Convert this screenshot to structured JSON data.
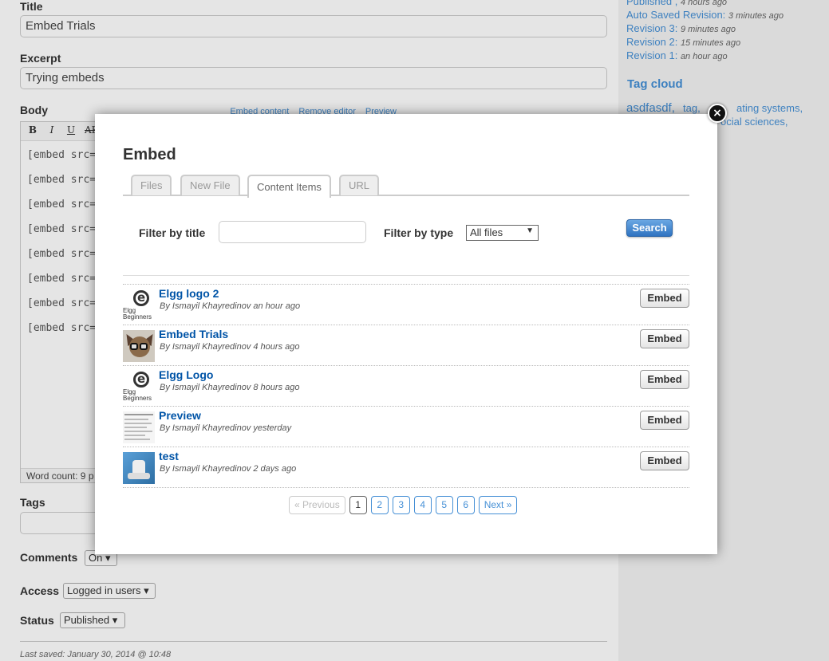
{
  "form": {
    "title_label": "Title",
    "title_value": "Embed Trials",
    "excerpt_label": "Excerpt",
    "excerpt_value": "Trying embeds",
    "body_label": "Body",
    "editor_links": [
      "Embed content",
      "Remove editor",
      "Preview"
    ],
    "toolbar": [
      "B",
      "I",
      "U",
      "AB"
    ],
    "body_lines": [
      "[embed src='",
      "[embed src='",
      "[embed src='",
      "[embed src='",
      "[embed src='",
      "[embed src='",
      "[embed src='",
      "[embed src='"
    ],
    "word_count": "Word count: 9 p",
    "tags_label": "Tags",
    "comments_label": "Comments",
    "comments_value": "On",
    "access_label": "Access",
    "access_value": "Logged in users",
    "status_label": "Status",
    "status_value": "Published",
    "last_saved": "Last saved: January 30, 2014 @ 10:48"
  },
  "sidebar": {
    "revisions": [
      {
        "label": "Published",
        "time": "4 hours ago"
      },
      {
        "label": "Auto Saved Revision:",
        "time": "3 minutes ago"
      },
      {
        "label": "Revision 3:",
        "time": "9 minutes ago"
      },
      {
        "label": "Revision 2:",
        "time": "15 minutes ago"
      },
      {
        "label": "Revision 1:",
        "time": "an hour ago"
      }
    ],
    "tag_cloud_heading": "Tag cloud",
    "tags": [
      "asdfasdf,",
      "tag,",
      "ating systems,",
      "ocial sciences,"
    ]
  },
  "modal": {
    "close_symbol": "×",
    "title": "Embed",
    "tabs": [
      "Files",
      "New File",
      "Content Items",
      "URL"
    ],
    "active_tab": "Content Items",
    "filter_title_label": "Filter by title",
    "filter_title_value": "",
    "filter_type_label": "Filter by type",
    "filter_type_value": "All files",
    "search_label": "Search",
    "items": [
      {
        "title": "Elgg logo 2",
        "meta": "By Ismayil Khayredinov an hour ago",
        "thumb": "elgg-logo",
        "embed_label": "Embed"
      },
      {
        "title": "Embed Trials",
        "meta": "By Ismayil Khayredinov 4 hours ago",
        "thumb": "dog-photo",
        "embed_label": "Embed"
      },
      {
        "title": "Elgg Logo",
        "meta": "By Ismayil Khayredinov 8 hours ago",
        "thumb": "elgg-logo",
        "embed_label": "Embed"
      },
      {
        "title": "Preview",
        "meta": "By Ismayil Khayredinov yesterday",
        "thumb": "document-preview",
        "embed_label": "Embed"
      },
      {
        "title": "test",
        "meta": "By Ismayil Khayredinov 2 days ago",
        "thumb": "robot-image",
        "embed_label": "Embed"
      }
    ],
    "elgg_thumb_text": [
      "Elgg",
      "Beginners"
    ],
    "pagination": {
      "previous": "« Previous",
      "pages": [
        "1",
        "2",
        "3",
        "4",
        "5",
        "6"
      ],
      "current": "1",
      "next": "Next »"
    }
  }
}
